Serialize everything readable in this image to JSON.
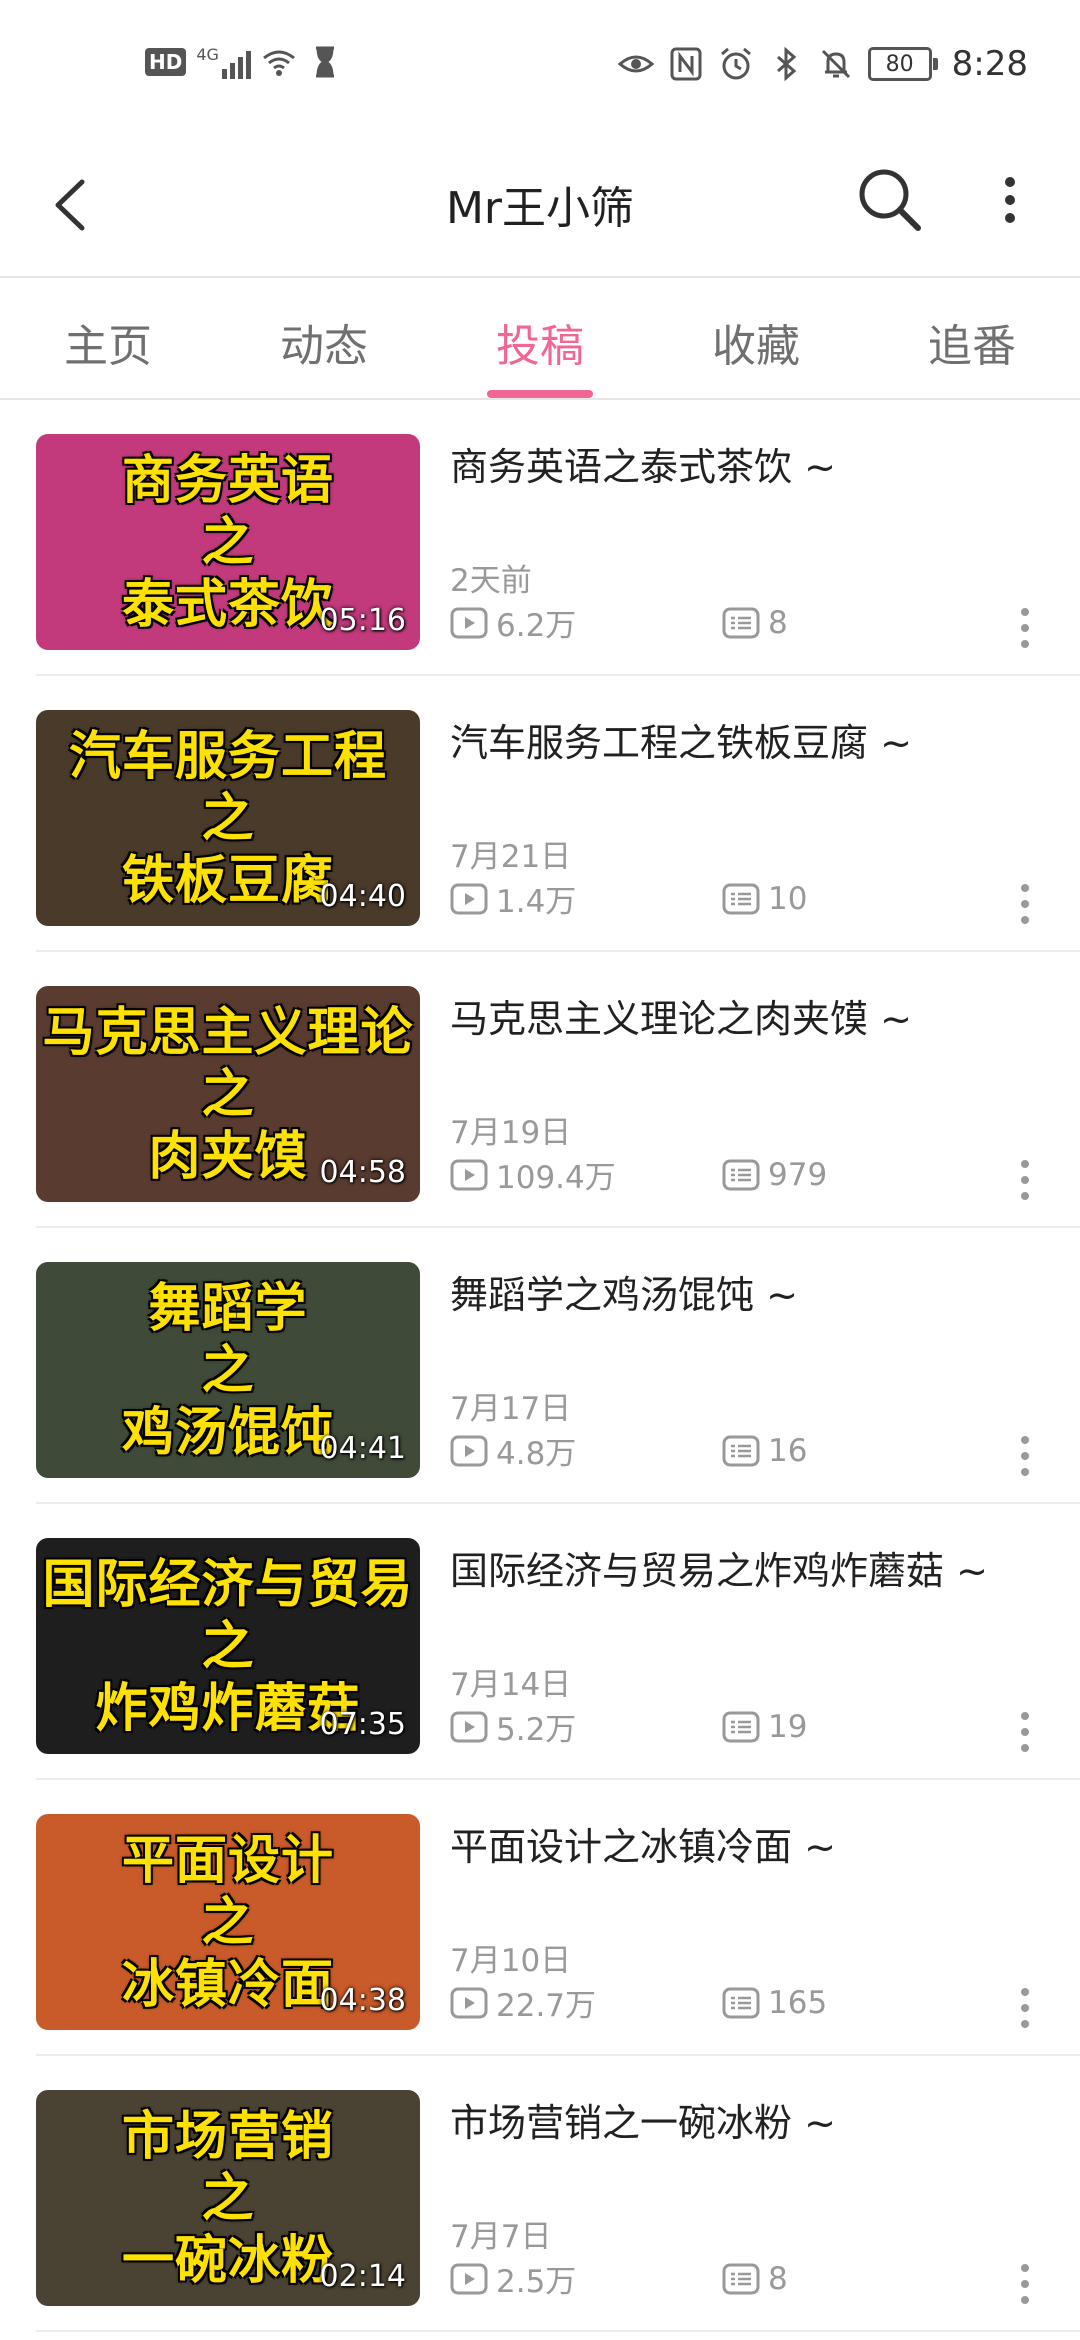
{
  "status_bar": {
    "left_label": "HD",
    "network": "4G",
    "battery": "80",
    "time": "8:28"
  },
  "header": {
    "title": "Mr王小筛"
  },
  "tabs": [
    {
      "label": "主页",
      "active": false
    },
    {
      "label": "动态",
      "active": false
    },
    {
      "label": "投稿",
      "active": true
    },
    {
      "label": "收藏",
      "active": false
    },
    {
      "label": "追番",
      "active": false
    }
  ],
  "colors": {
    "accent": "#f06696",
    "caption_yellow": "#ffe100"
  },
  "videos": [
    {
      "title": "商务英语之泰式茶饮 ~",
      "date": "2天前",
      "views": "6.2万",
      "comments": "8",
      "duration": "05:16",
      "caption": [
        "商务英语",
        "之",
        "泰式茶饮"
      ],
      "bg": "#c23a7c"
    },
    {
      "title": "汽车服务工程之铁板豆腐 ~",
      "date": "7月21日",
      "views": "1.4万",
      "comments": "10",
      "duration": "04:40",
      "caption": [
        "汽车服务工程",
        "之",
        "铁板豆腐"
      ],
      "bg": "#4a3a2a"
    },
    {
      "title": "马克思主义理论之肉夹馍 ~",
      "date": "7月19日",
      "views": "109.4万",
      "comments": "979",
      "duration": "04:58",
      "caption": [
        "马克思主义理论",
        "之",
        "肉夹馍"
      ],
      "bg": "#5a3b30"
    },
    {
      "title": "舞蹈学之鸡汤馄饨 ~",
      "date": "7月17日",
      "views": "4.8万",
      "comments": "16",
      "duration": "04:41",
      "caption": [
        "舞蹈学",
        "之",
        "鸡汤馄饨"
      ],
      "bg": "#3f4a38"
    },
    {
      "title": "国际经济与贸易之炸鸡炸蘑菇 ~",
      "date": "7月14日",
      "views": "5.2万",
      "comments": "19",
      "duration": "07:35",
      "caption": [
        "国际经济与贸易",
        "之",
        "炸鸡炸蘑菇"
      ],
      "bg": "#1e1e1e"
    },
    {
      "title": "平面设计之冰镇冷面 ~",
      "date": "7月10日",
      "views": "22.7万",
      "comments": "165",
      "duration": "04:38",
      "caption": [
        "平面设计",
        "之",
        "冰镇冷面"
      ],
      "bg": "#c95a2a"
    },
    {
      "title": "市场营销之一碗冰粉 ~",
      "date": "7月7日",
      "views": "2.5万",
      "comments": "8",
      "duration": "02:14",
      "caption": [
        "市场营销",
        "之",
        "一碗冰粉"
      ],
      "bg": "#4a4232"
    }
  ]
}
